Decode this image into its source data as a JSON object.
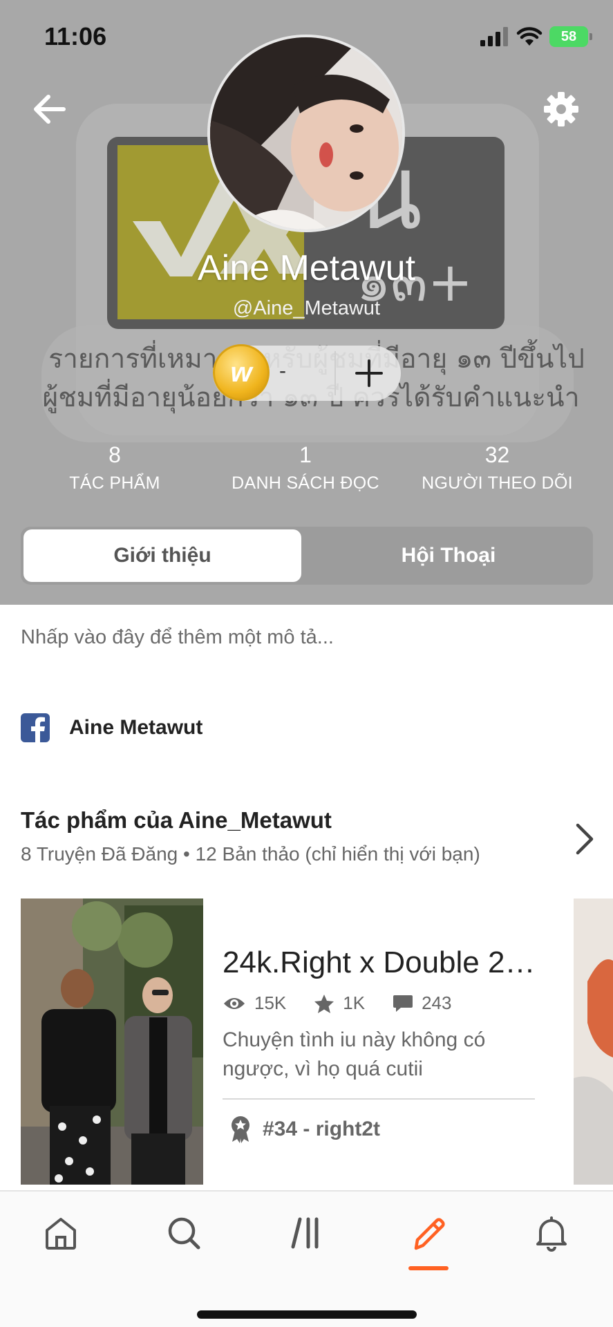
{
  "status_bar": {
    "time": "11:06",
    "battery": "58"
  },
  "profile": {
    "display_name": "Aine Metawut",
    "username": "@Aine_Metawut",
    "coins": "-",
    "cover_text_line1": "รายการที่เหมาะสำหรับผู้ชมที่มีอายุ ๑๓ ปีขึ้นไป",
    "cover_text_line2": "ผู้ชมที่มีอายุน้อยกว่า ๑๓ ปี ควรได้รับคำแนะนำ",
    "cover_badge": "๑๓+",
    "cover_badge_big": "น"
  },
  "stats": [
    {
      "value": "8",
      "label": "TÁC PHẨM"
    },
    {
      "value": "1",
      "label": "DANH SÁCH ĐỌC"
    },
    {
      "value": "32",
      "label": "NGƯỜI THEO DÕI"
    }
  ],
  "tabs": [
    {
      "label": "Giới thiệu",
      "active": true
    },
    {
      "label": "Hội Thoại",
      "active": false
    }
  ],
  "about": {
    "description_placeholder": "Nhấp vào đây để thêm một mô tả...",
    "facebook_name": "Aine Metawut"
  },
  "works": {
    "title": "Tác phẩm của Aine_Metawut",
    "subtitle": "8 Truyện Đã Đăng • 12 Bản thảo (chỉ hiển thị với bạn)",
    "stories": [
      {
        "title": "24k.Right x Double 2…",
        "reads": "15K",
        "votes": "1K",
        "comments": "243",
        "description": "Chuyện tình iu này không có ngược, vì họ quá cutii",
        "rank": "#34 - right2t"
      }
    ]
  },
  "colors": {
    "header_bg": "#a7a7a7",
    "accent": "#ff6122",
    "facebook": "#3b5998"
  },
  "icons": [
    "back-arrow-icon",
    "gear-icon",
    "coin-icon",
    "plus-icon",
    "facebook-icon",
    "chevron-right-icon",
    "eye-icon",
    "star-icon",
    "comment-icon",
    "ribbon-icon",
    "home-icon",
    "search-icon",
    "library-icon",
    "pencil-icon",
    "bell-icon"
  ]
}
